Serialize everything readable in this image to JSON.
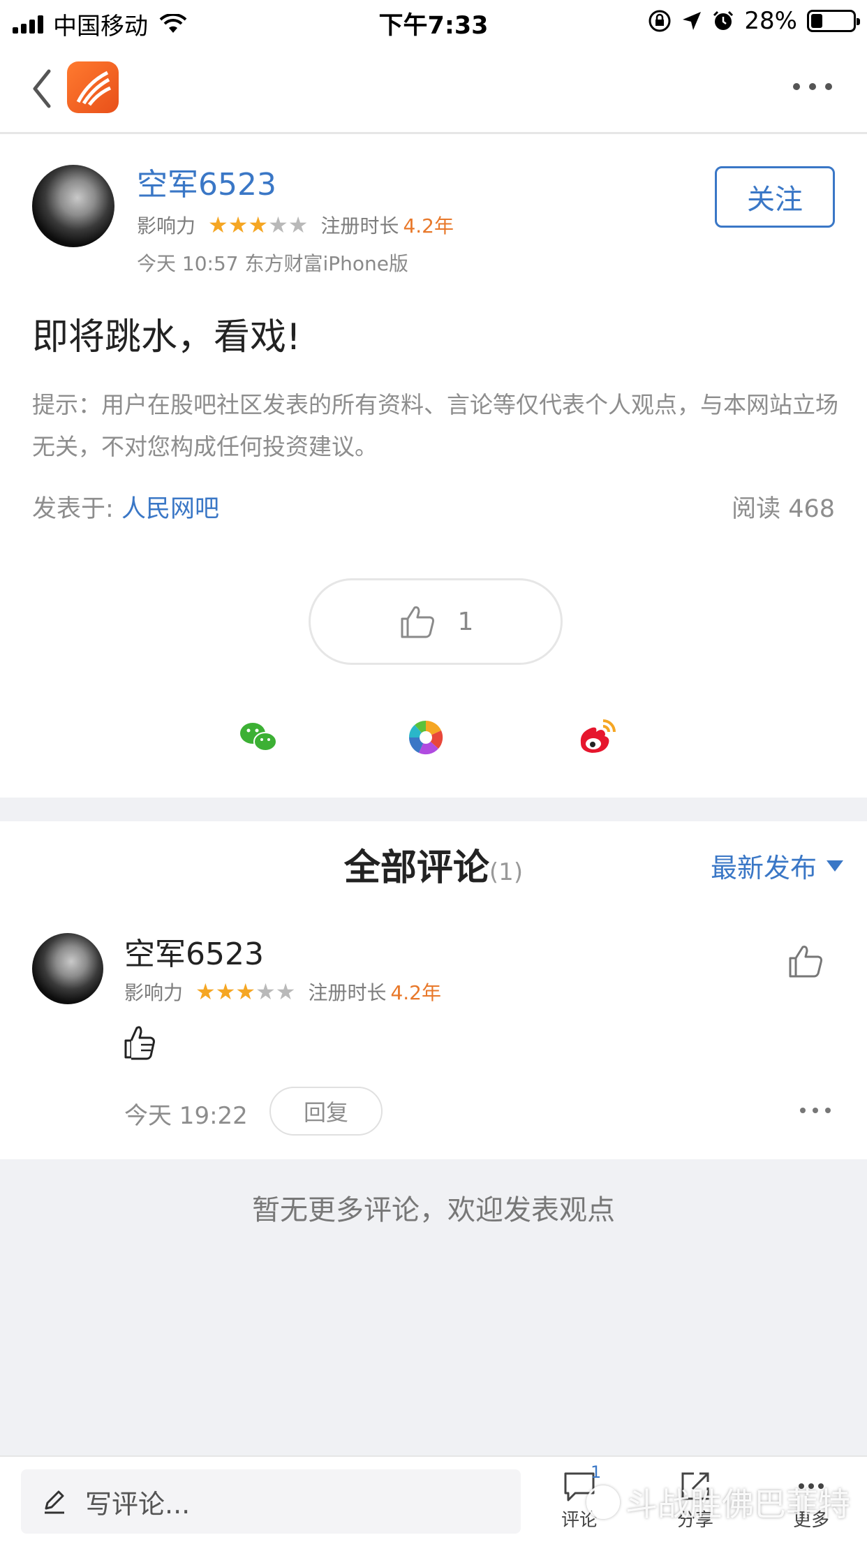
{
  "status_bar": {
    "carrier": "中国移动",
    "time": "下午7:33",
    "battery_percent": "28%",
    "battery_level": 0.28
  },
  "post": {
    "author": "空军6523",
    "influence_label": "影响力",
    "influence_stars": 3,
    "reg_label": "注册时长",
    "reg_years": "4.2年",
    "post_time_source": "今天 10:57 东方财富iPhone版",
    "follow_label": "关注",
    "title": "即将跳水，看戏!",
    "disclaimer": "提示：用户在股吧社区发表的所有资料、言论等仅代表个人观点，与本网站立场无关，不对您构成任何投资建议。",
    "posted_in_label": "发表于:",
    "forum": "人民网吧",
    "reads": "阅读 468",
    "like_count": "1"
  },
  "share_icons": [
    "wechat-icon",
    "moments-icon",
    "weibo-icon"
  ],
  "comments": {
    "title": "全部评论",
    "count": "(1)",
    "sort_label": "最新发布",
    "items": [
      {
        "author": "空军6523",
        "influence_label": "影响力",
        "influence_stars": 3,
        "reg_label": "注册时长",
        "reg_years": "4.2年",
        "body_icon": "thumbs-up-emoji-icon",
        "time": "今天 19:22",
        "reply_label": "回复"
      }
    ],
    "empty_text": "暂无更多评论，欢迎发表观点"
  },
  "toolbar": {
    "composer_placeholder": "写评论...",
    "comment_label": "评论",
    "comment_badge": "1",
    "share_label": "分享",
    "more_label": "更多"
  },
  "watermark": "斗战胜佛巴菲特",
  "colors": {
    "accent_blue": "#3a77c6",
    "star_orange": "#f5a623",
    "reg_orange": "#e8782a",
    "background_gray": "#f0f1f4"
  }
}
